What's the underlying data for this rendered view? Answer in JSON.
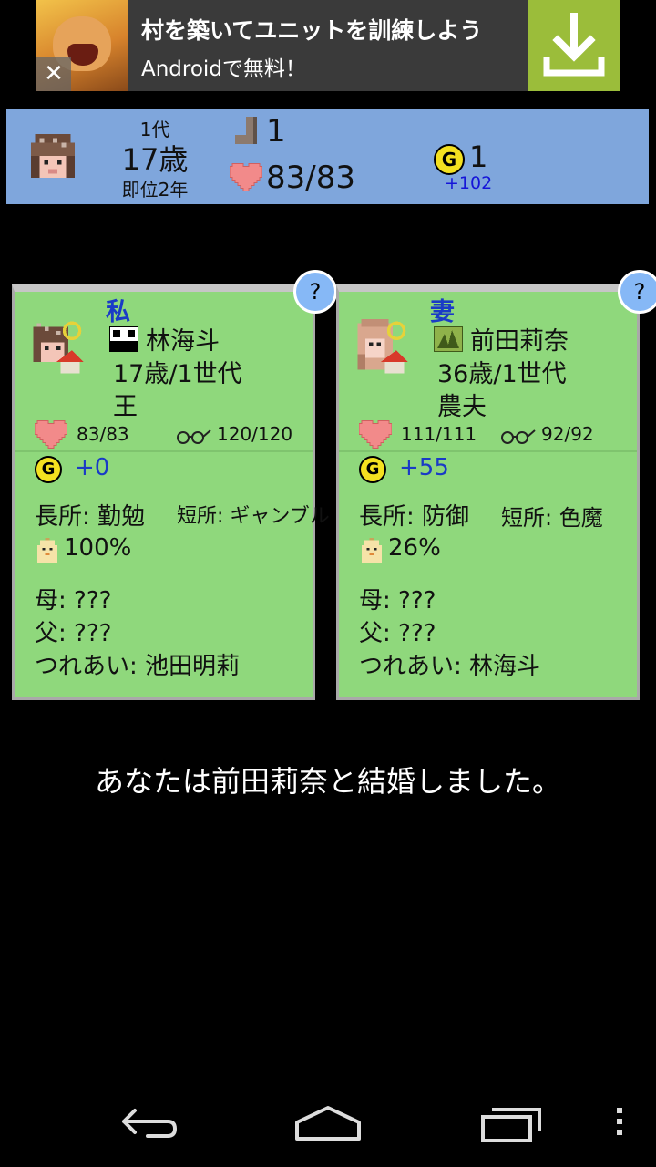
{
  "ad": {
    "title": "村を築いてユニットを訓練しよう",
    "subtitle": "Androidで無料！",
    "close_glyph": "✕",
    "button_color": "#9bbd3a"
  },
  "status": {
    "generation": "1代",
    "age": "17歳",
    "reign": "即位2年",
    "steps": "1",
    "hp": "83/83",
    "gold": "1",
    "gold_income": "+102",
    "gold_icon": "G",
    "panel_color": "#7fa6dc"
  },
  "cards": {
    "me": {
      "relation": "私",
      "help": "?",
      "name": "林海斗",
      "age_gen": "17歳/1世代",
      "job": "王",
      "hp": "83/83",
      "wisdom": "120/120",
      "gold_icon": "G",
      "income": "+0",
      "strength": "長所: 勤勉",
      "weakness": "短所: ギャンブル",
      "fertility": "100%",
      "mother": "母: ???",
      "father": "父: ???",
      "spouse": "つれあい: 池田明莉"
    },
    "wife": {
      "relation": "妻",
      "help": "?",
      "name": "前田莉奈",
      "age_gen": "36歳/1世代",
      "job": "農夫",
      "hp": "111/111",
      "wisdom": "92/92",
      "gold_icon": "G",
      "income": "+55",
      "strength": "長所: 防御",
      "weakness": "短所: 色魔",
      "fertility": "26%",
      "mother": "母: ???",
      "father": "父: ???",
      "spouse": "つれあい: 林海斗"
    }
  },
  "message": "あなたは前田莉奈と結婚しました。",
  "colors": {
    "card_bg": "#8fd87c",
    "accent_blue": "#1a3bc6",
    "heart": "#f28a8a",
    "coin": "#f4e020"
  },
  "nav": {
    "icons": [
      "back-icon",
      "home-icon",
      "recents-icon",
      "menu-icon"
    ]
  }
}
